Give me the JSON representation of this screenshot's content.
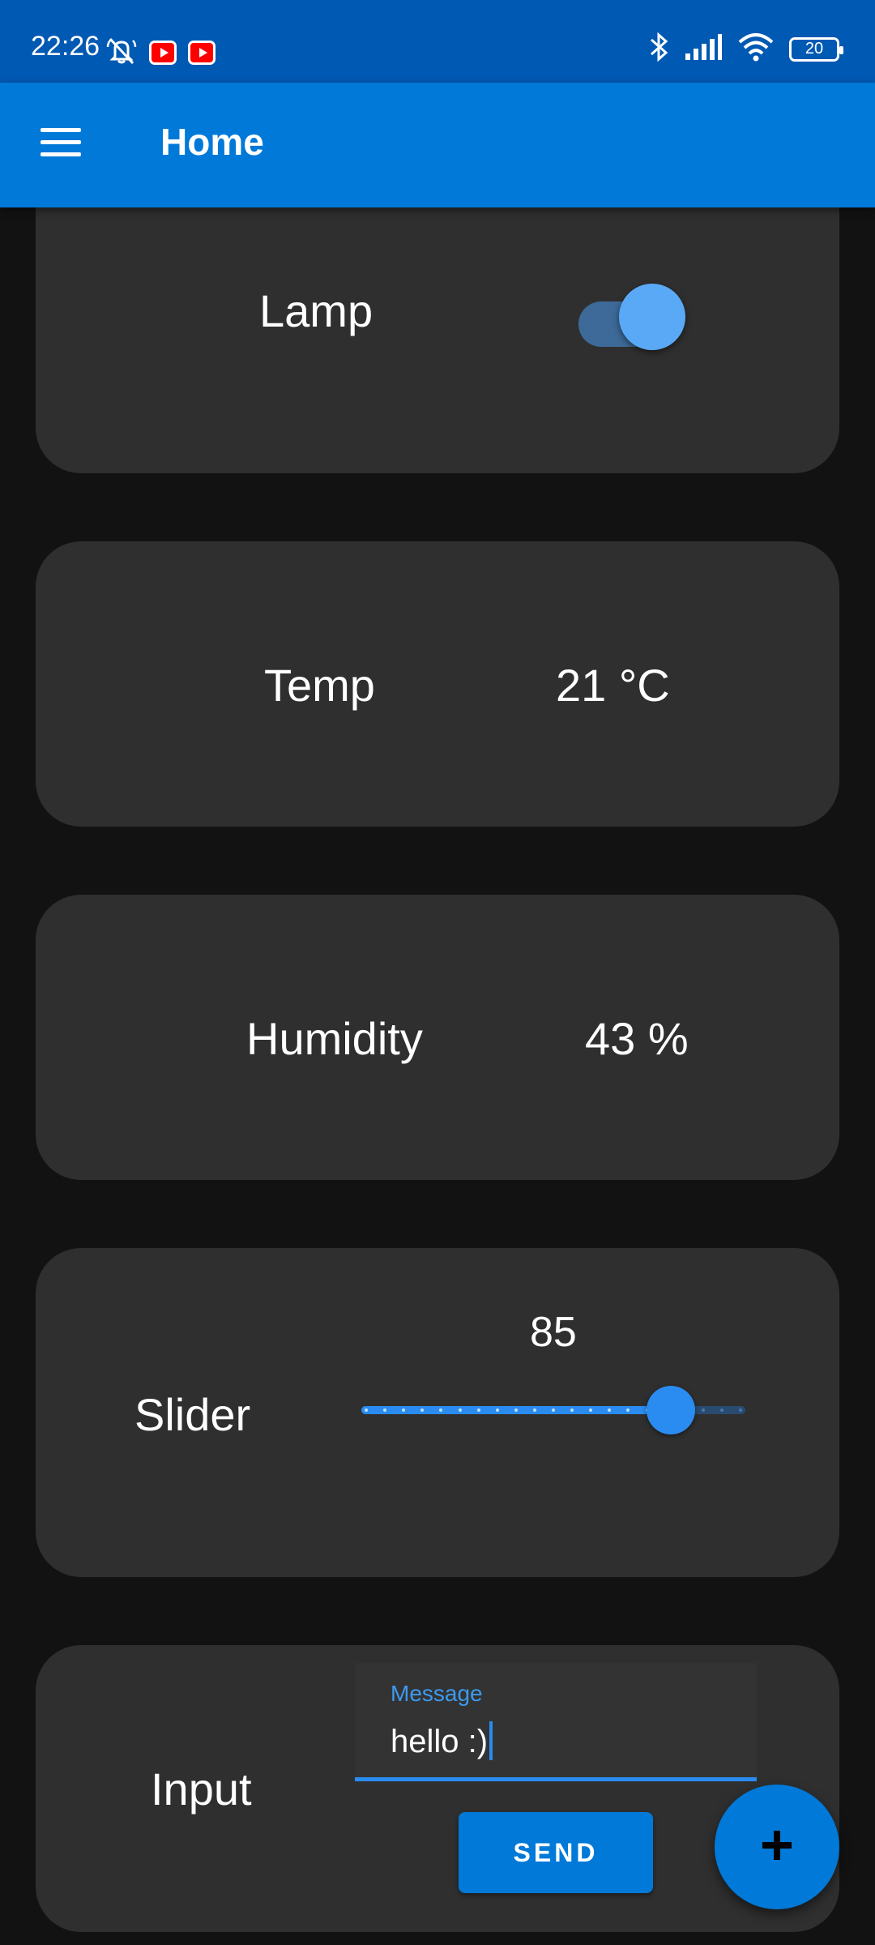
{
  "status_bar": {
    "time": "22:26",
    "battery": "20",
    "icons": [
      "mute-icon",
      "youtube-icon",
      "youtube-icon",
      "bluetooth-icon",
      "signal-icon",
      "wifi-icon",
      "battery-icon"
    ]
  },
  "app_bar": {
    "title": "Home",
    "menu_icon": "menu-icon"
  },
  "cards": {
    "lamp": {
      "label": "Lamp",
      "switch_on": true
    },
    "temp": {
      "label": "Temp",
      "value": "21 °C"
    },
    "humidity": {
      "label": "Humidity",
      "value": "43 %"
    },
    "slider": {
      "label": "Slider",
      "value": "85",
      "level_percent": 85
    },
    "input": {
      "label": "Input",
      "field_label": "Message",
      "field_value": "hello :)",
      "send_label": "SEND"
    }
  },
  "fab": {
    "icon": "plus-icon"
  },
  "colors": {
    "status_bar": "#0059b3",
    "app_bar": "#0079d8",
    "background": "#121212",
    "card": "#2f2f2f",
    "accent": "#2a8cf0"
  }
}
